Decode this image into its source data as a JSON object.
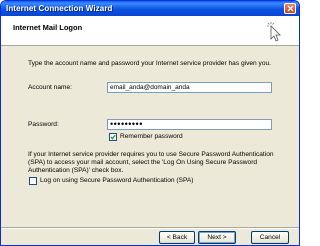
{
  "window": {
    "title": "Internet Connection Wizard"
  },
  "header": {
    "title": "Internet Mail Logon"
  },
  "intro": "Type the account name and password your Internet service provider has given you.",
  "account": {
    "label": "Account name:",
    "value": "email_anda@domain_anda"
  },
  "password": {
    "label": "Password:",
    "value": "•••••••••"
  },
  "remember": {
    "label": "Remember password",
    "checked": true
  },
  "spa_info": {
    "line1": "If your Internet service provider requires you to use Secure Password Authentication",
    "line2": "(SPA) to access your mail account, select the 'Log On Using Secure Password",
    "line3": "Authentication (SPA)' check box."
  },
  "spa": {
    "label": "Log on using Secure Password Authentication (SPA)",
    "checked": false
  },
  "buttons": {
    "back": "< Back",
    "next": "Next >",
    "cancel": "Cancel"
  },
  "icons": {
    "close": "close-icon",
    "header": "wizard-cursor-icon"
  }
}
